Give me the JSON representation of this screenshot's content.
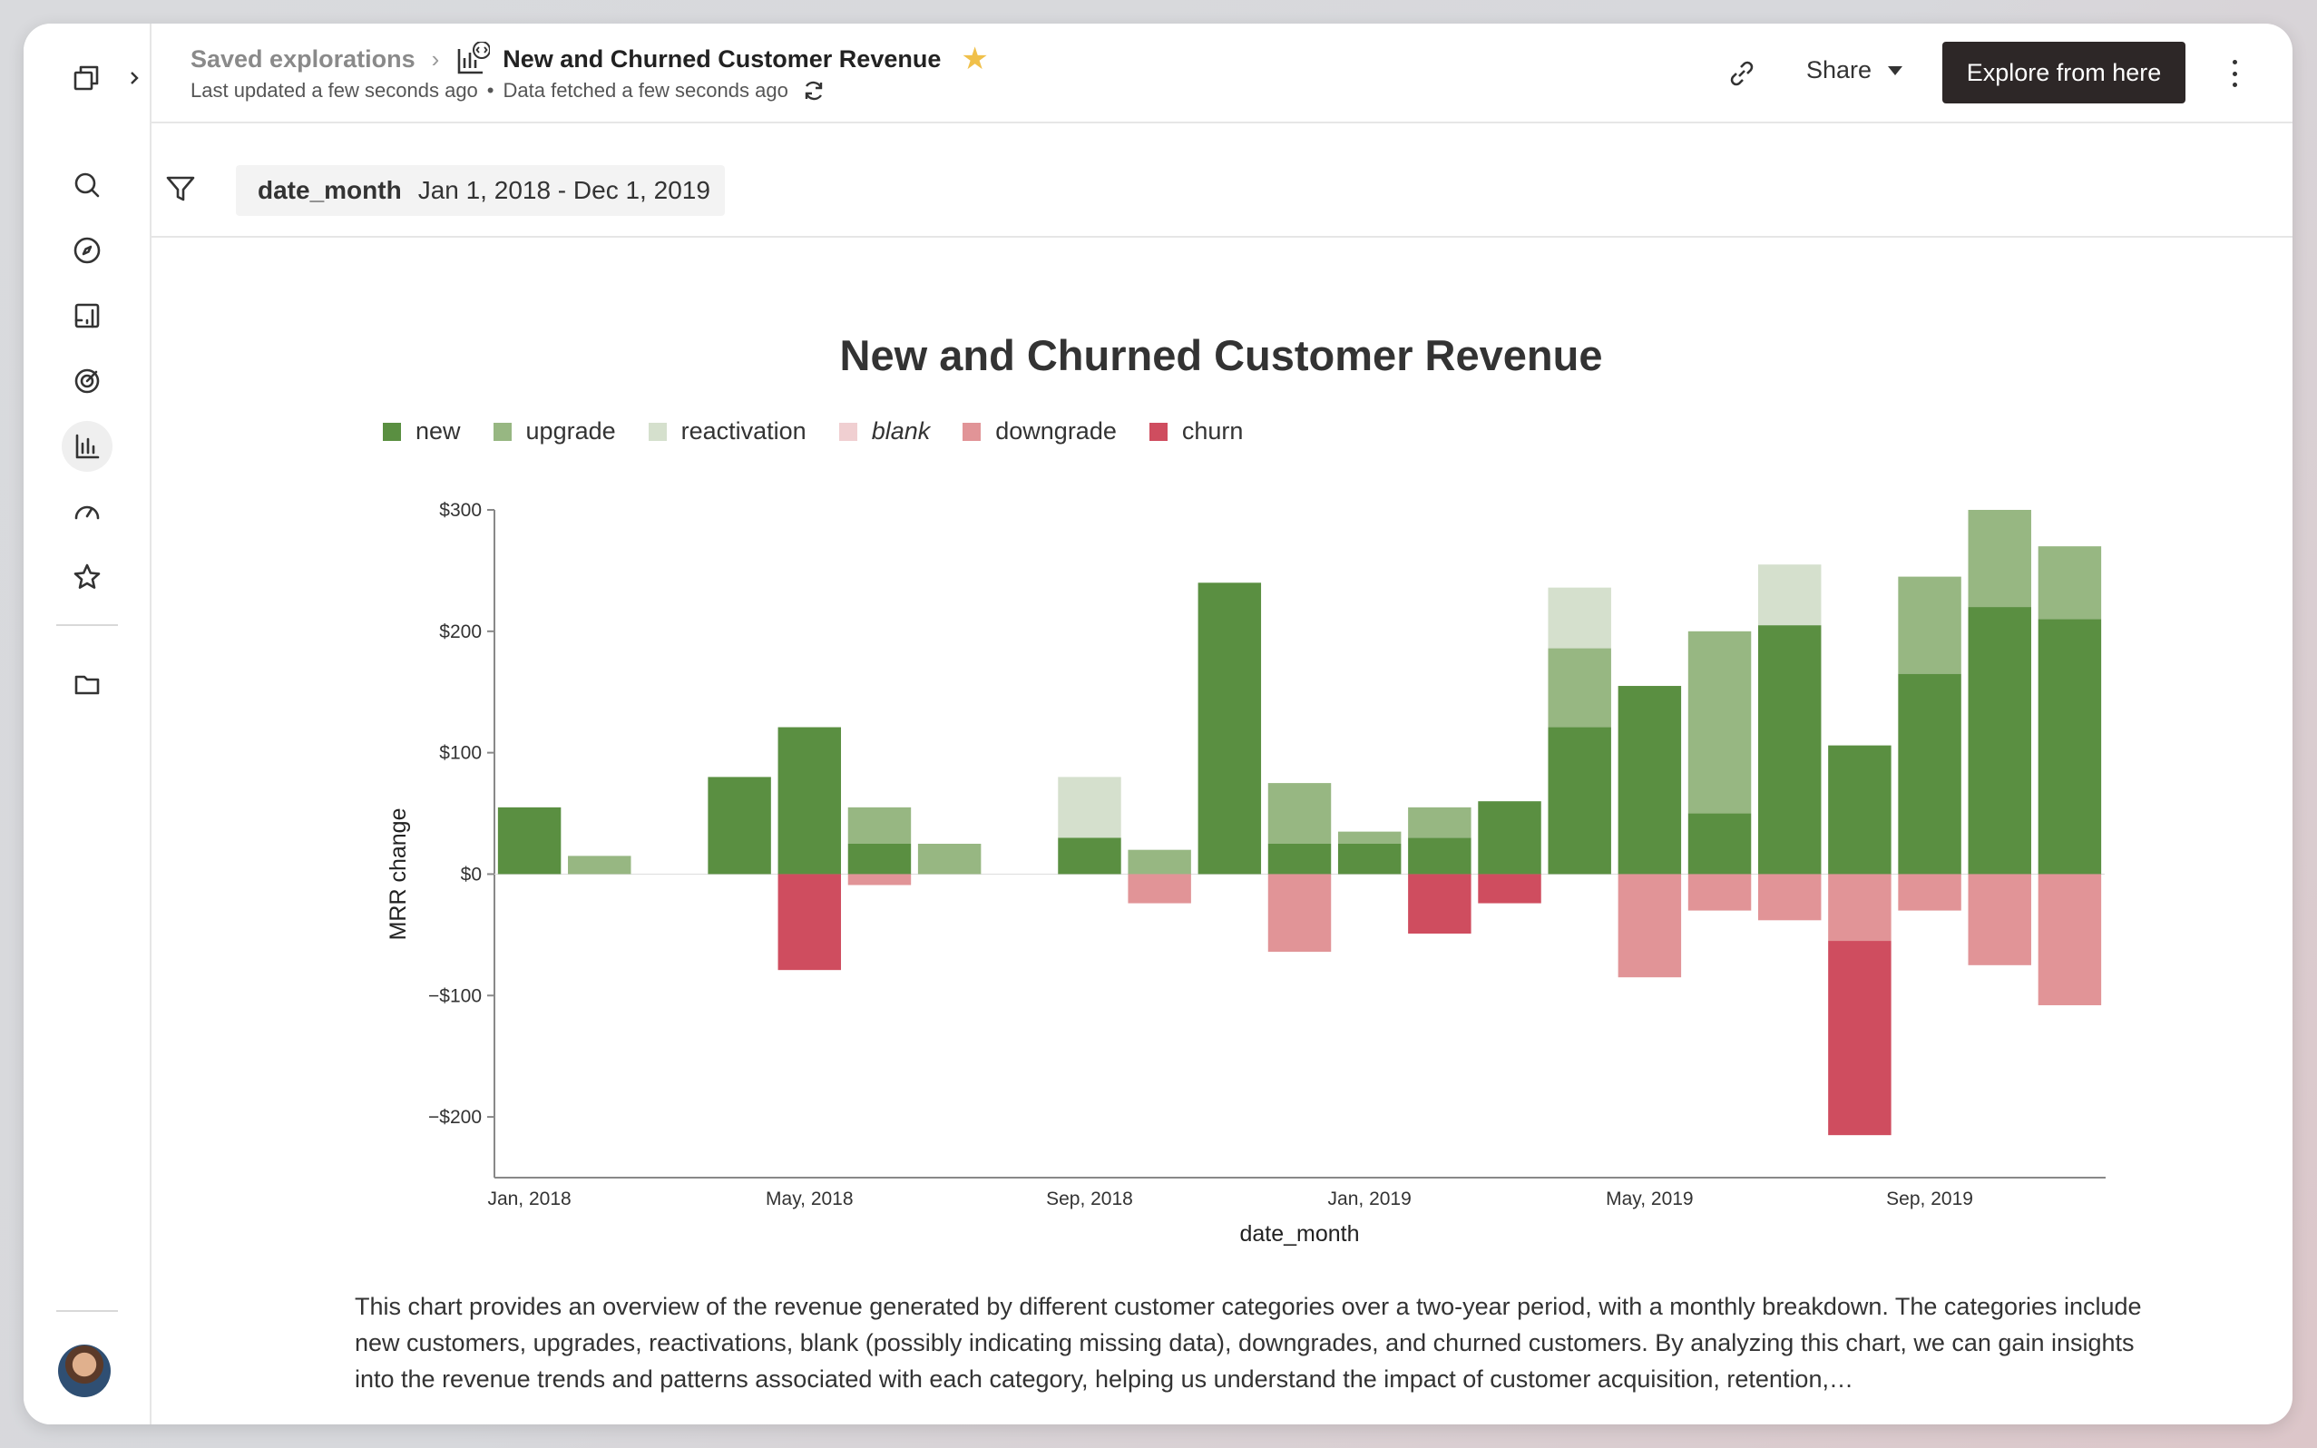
{
  "breadcrumb": {
    "parent": "Saved explorations",
    "title": "New and Churned Customer Revenue"
  },
  "meta": {
    "updated": "Last updated a few seconds ago",
    "separator": "•",
    "fetched": "Data fetched a few seconds ago"
  },
  "header": {
    "share_label": "Share",
    "explore_label": "Explore from here"
  },
  "filter": {
    "name": "date_month",
    "value": "Jan 1, 2018 - Dec 1, 2019"
  },
  "chart_data": {
    "type": "bar",
    "stacked": true,
    "title": "New and Churned Customer Revenue",
    "xlabel": "date_month",
    "ylabel": "MRR change",
    "ylim": [
      -250,
      300
    ],
    "yticks": [
      300,
      200,
      100,
      0,
      -100,
      -200
    ],
    "ytick_labels": [
      "$300",
      "$200",
      "$100",
      "$0",
      "−$100",
      "−$200"
    ],
    "xtick_labels": [
      {
        "index": 0,
        "label": "Jan, 2018"
      },
      {
        "index": 4,
        "label": "May, 2018"
      },
      {
        "index": 8,
        "label": "Sep, 2018"
      },
      {
        "index": 12,
        "label": "Jan, 2019"
      },
      {
        "index": 16,
        "label": "May, 2019"
      },
      {
        "index": 20,
        "label": "Sep, 2019"
      }
    ],
    "grid": false,
    "legend_position": "top-left",
    "categories": [
      "2018-01",
      "2018-02",
      "2018-03",
      "2018-04",
      "2018-05",
      "2018-06",
      "2018-07",
      "2018-08",
      "2018-09",
      "2018-10",
      "2018-11",
      "2018-12",
      "2019-01",
      "2019-02",
      "2019-03",
      "2019-04",
      "2019-05",
      "2019-06",
      "2019-07",
      "2019-08",
      "2019-09",
      "2019-10",
      "2019-11"
    ],
    "series": [
      {
        "name": "new",
        "color": "#5a8f41",
        "values": [
          55,
          0,
          0,
          80,
          121,
          25,
          0,
          0,
          30,
          0,
          240,
          25,
          25,
          30,
          60,
          121,
          155,
          50,
          205,
          106,
          165,
          220,
          210
        ]
      },
      {
        "name": "upgrade",
        "color": "#97b782",
        "values": [
          0,
          15,
          0,
          0,
          0,
          30,
          25,
          0,
          0,
          20,
          0,
          50,
          10,
          25,
          0,
          65,
          0,
          150,
          0,
          0,
          80,
          80,
          60
        ]
      },
      {
        "name": "reactivation",
        "color": "#d5e0cd",
        "values": [
          0,
          0,
          0,
          0,
          0,
          0,
          0,
          0,
          50,
          0,
          0,
          0,
          0,
          0,
          0,
          50,
          0,
          0,
          50,
          0,
          0,
          0,
          0
        ]
      },
      {
        "name": "blank",
        "color": "#f0cfd1",
        "values": [
          0,
          0,
          0,
          0,
          0,
          0,
          0,
          0,
          0,
          0,
          0,
          0,
          0,
          0,
          0,
          0,
          0,
          0,
          0,
          0,
          0,
          0,
          0
        ]
      },
      {
        "name": "downgrade",
        "color": "#e19497",
        "values": [
          0,
          0,
          0,
          0,
          0,
          -9,
          0,
          0,
          0,
          -24,
          0,
          -64,
          0,
          0,
          0,
          0,
          -85,
          -30,
          -38,
          -55,
          -30,
          -75,
          -108
        ]
      },
      {
        "name": "churn",
        "color": "#cf4d5f",
        "values": [
          0,
          0,
          0,
          0,
          -79,
          0,
          0,
          0,
          0,
          0,
          0,
          0,
          0,
          -49,
          -24,
          0,
          0,
          0,
          0,
          -160,
          0,
          0,
          0
        ]
      }
    ]
  },
  "description": "This chart provides an overview of the revenue generated by different customer categories over a two-year period, with a monthly breakdown. The categories include new customers, upgrades, reactivations, blank (possibly indicating missing data), downgrades, and churned customers. By analyzing this chart, we can gain insights into the revenue trends and patterns associated with each category, helping us understand the impact of customer acquisition, retention,…",
  "icons": {
    "sidebar": [
      "logo-icon",
      "search-icon",
      "compass-icon",
      "dashboard-icon",
      "target-icon",
      "chart-bar-icon",
      "gauge-icon",
      "star-icon",
      "folder-icon"
    ],
    "star_color": "#f0c04a"
  }
}
